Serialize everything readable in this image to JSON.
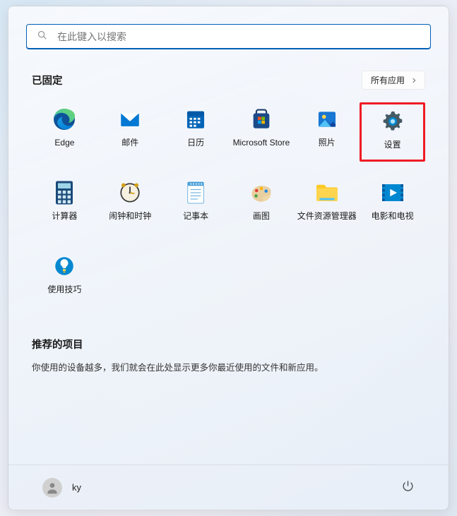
{
  "search": {
    "placeholder": "在此键入以搜索"
  },
  "pinned": {
    "title": "已固定",
    "all_apps_label": "所有应用",
    "apps": [
      {
        "label": "Edge",
        "icon": "edge"
      },
      {
        "label": "邮件",
        "icon": "mail"
      },
      {
        "label": "日历",
        "icon": "calendar"
      },
      {
        "label": "Microsoft Store",
        "icon": "store"
      },
      {
        "label": "照片",
        "icon": "photos"
      },
      {
        "label": "设置",
        "icon": "settings",
        "highlight": true
      },
      {
        "label": "计算器",
        "icon": "calculator"
      },
      {
        "label": "闹钟和时钟",
        "icon": "clock"
      },
      {
        "label": "记事本",
        "icon": "notepad"
      },
      {
        "label": "画图",
        "icon": "paint"
      },
      {
        "label": "文件资源管理器",
        "icon": "explorer"
      },
      {
        "label": "电影和电视",
        "icon": "movies"
      },
      {
        "label": "使用技巧",
        "icon": "tips"
      }
    ]
  },
  "recommended": {
    "title": "推荐的项目",
    "text": "你使用的设备越多，我们就会在此处显示更多你最近使用的文件和新应用。"
  },
  "user": {
    "name": "ky"
  }
}
